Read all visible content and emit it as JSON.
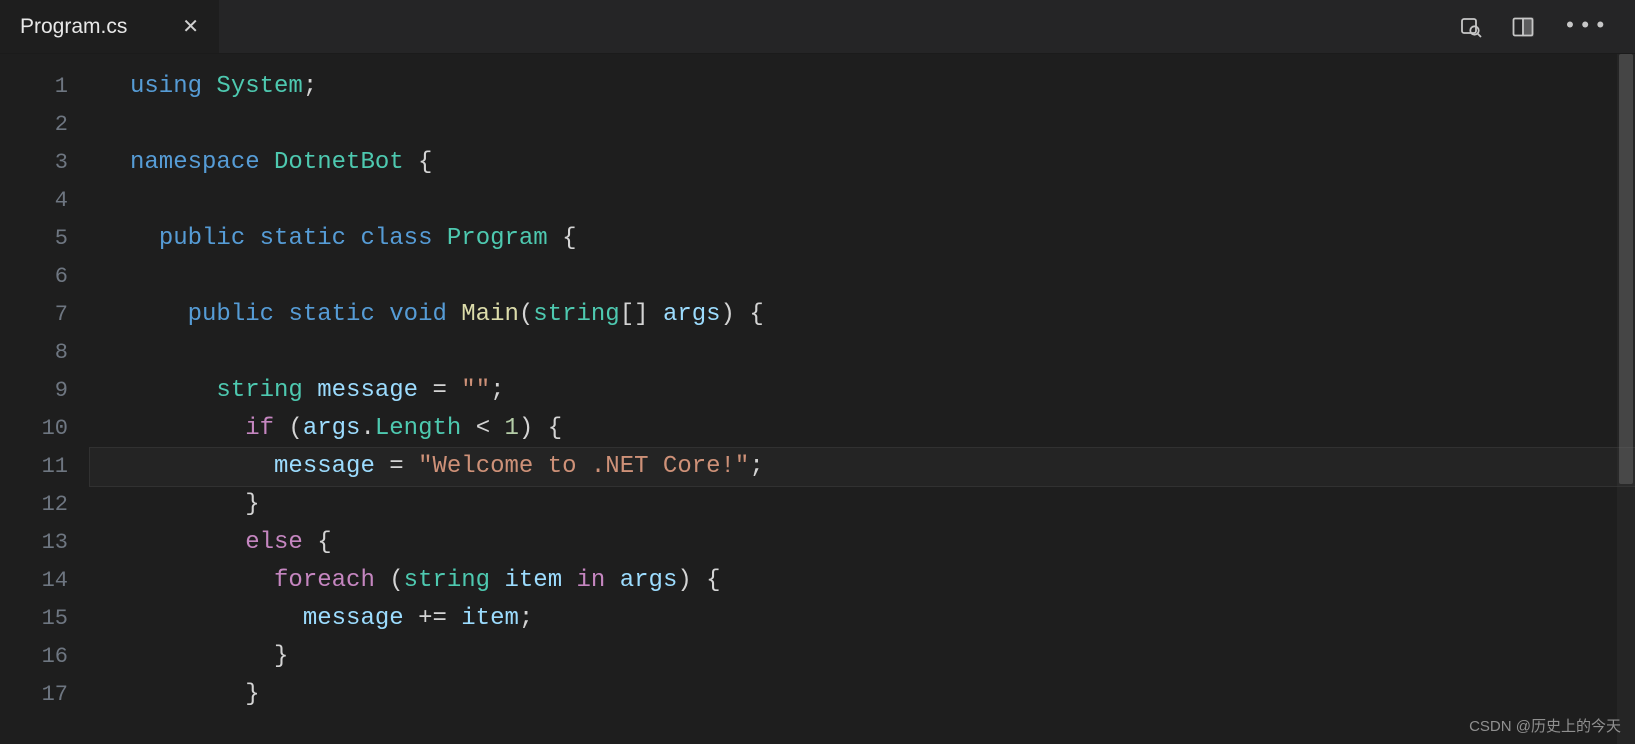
{
  "tab": {
    "filename": "Program.cs"
  },
  "editor": {
    "current_line": 11,
    "lines": [
      {
        "n": 1,
        "tokens": [
          [
            "kw",
            "using"
          ],
          [
            "pun",
            " "
          ],
          [
            "ns",
            "System"
          ],
          [
            "pun",
            ";"
          ]
        ]
      },
      {
        "n": 2,
        "tokens": []
      },
      {
        "n": 3,
        "tokens": [
          [
            "kw",
            "namespace"
          ],
          [
            "pun",
            " "
          ],
          [
            "ns",
            "DotnetBot"
          ],
          [
            "pun",
            " {"
          ]
        ]
      },
      {
        "n": 4,
        "tokens": []
      },
      {
        "n": 5,
        "tokens": [
          [
            "pun",
            "  "
          ],
          [
            "kw",
            "public"
          ],
          [
            "pun",
            " "
          ],
          [
            "kw",
            "static"
          ],
          [
            "pun",
            " "
          ],
          [
            "typekw",
            "class"
          ],
          [
            "pun",
            " "
          ],
          [
            "ns",
            "Program"
          ],
          [
            "pun",
            " {"
          ]
        ]
      },
      {
        "n": 6,
        "tokens": []
      },
      {
        "n": 7,
        "tokens": [
          [
            "pun",
            "    "
          ],
          [
            "kw",
            "public"
          ],
          [
            "pun",
            " "
          ],
          [
            "kw",
            "static"
          ],
          [
            "pun",
            " "
          ],
          [
            "kw",
            "void"
          ],
          [
            "pun",
            " "
          ],
          [
            "fn",
            "Main"
          ],
          [
            "pun",
            "("
          ],
          [
            "type",
            "string"
          ],
          [
            "pun",
            "[] "
          ],
          [
            "va",
            "args"
          ],
          [
            "pun",
            ") {"
          ]
        ]
      },
      {
        "n": 8,
        "tokens": []
      },
      {
        "n": 9,
        "tokens": [
          [
            "pun",
            "      "
          ],
          [
            "type",
            "string"
          ],
          [
            "pun",
            " "
          ],
          [
            "va",
            "message"
          ],
          [
            "pun",
            " "
          ],
          [
            "op",
            "="
          ],
          [
            "pun",
            " "
          ],
          [
            "str",
            "\"\""
          ],
          [
            "pun",
            ";"
          ]
        ]
      },
      {
        "n": 10,
        "tokens": [
          [
            "pun",
            "        "
          ],
          [
            "ctrl",
            "if"
          ],
          [
            "pun",
            " ("
          ],
          [
            "va",
            "args"
          ],
          [
            "pun",
            "."
          ],
          [
            "ns",
            "Length"
          ],
          [
            "pun",
            " "
          ],
          [
            "op",
            "<"
          ],
          [
            "pun",
            " "
          ],
          [
            "num",
            "1"
          ],
          [
            "pun",
            ") {"
          ]
        ]
      },
      {
        "n": 11,
        "tokens": [
          [
            "pun",
            "          "
          ],
          [
            "va",
            "message"
          ],
          [
            "pun",
            " "
          ],
          [
            "op",
            "="
          ],
          [
            "pun",
            " "
          ],
          [
            "str",
            "\"Welcome to .NET Core!\""
          ],
          [
            "pun",
            ";"
          ]
        ]
      },
      {
        "n": 12,
        "tokens": [
          [
            "pun",
            "        }"
          ]
        ]
      },
      {
        "n": 13,
        "tokens": [
          [
            "pun",
            "        "
          ],
          [
            "ctrl",
            "else"
          ],
          [
            "pun",
            " {"
          ]
        ]
      },
      {
        "n": 14,
        "tokens": [
          [
            "pun",
            "          "
          ],
          [
            "ctrl",
            "foreach"
          ],
          [
            "pun",
            " ("
          ],
          [
            "type",
            "string"
          ],
          [
            "pun",
            " "
          ],
          [
            "va",
            "item"
          ],
          [
            "pun",
            " "
          ],
          [
            "ctrl",
            "in"
          ],
          [
            "pun",
            " "
          ],
          [
            "va",
            "args"
          ],
          [
            "pun",
            ") {"
          ]
        ]
      },
      {
        "n": 15,
        "tokens": [
          [
            "pun",
            "            "
          ],
          [
            "va",
            "message"
          ],
          [
            "pun",
            " "
          ],
          [
            "op",
            "+="
          ],
          [
            "pun",
            " "
          ],
          [
            "va",
            "item"
          ],
          [
            "pun",
            ";"
          ]
        ]
      },
      {
        "n": 16,
        "tokens": [
          [
            "pun",
            "          }"
          ]
        ]
      },
      {
        "n": 17,
        "tokens": [
          [
            "pun",
            "        }"
          ]
        ]
      }
    ]
  },
  "watermark": "CSDN @历史上的今天",
  "icons": {
    "find": "find-icon",
    "split": "split-editor-icon",
    "more": "more-actions-icon"
  }
}
